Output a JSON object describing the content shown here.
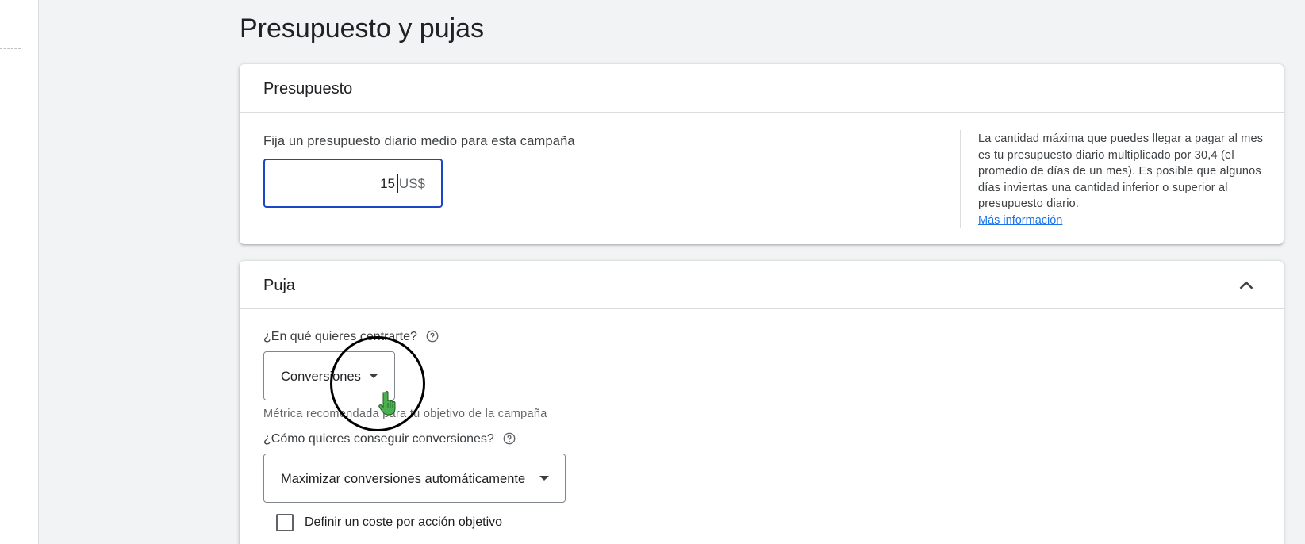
{
  "page": {
    "title": "Presupuesto y pujas"
  },
  "budget": {
    "header_title": "Presupuesto",
    "label": "Fija un presupuesto diario medio para esta campaña",
    "input_value": "15",
    "currency": "US$",
    "help_text": "La cantidad máxima que puedes llegar a pagar al mes es tu presupuesto diario multiplicado por 30,4 (el promedio de días de un mes). Es posible que algunos días inviertas una cantidad inferior o superior al presupuesto diario.",
    "help_link": "Más información"
  },
  "bid": {
    "header_title": "Puja",
    "question_focus": "¿En qué quieres centrarte?",
    "focus_selected": "Conversiones",
    "focus_hint": "Métrica recomendada para tu objetivo de la campaña",
    "question_how": "¿Cómo quieres conseguir conversiones?",
    "how_selected": "Maximizar conversiones automáticamente",
    "target_cpa_label": "Definir un coste por acción objetivo",
    "target_cpa_checked": false
  },
  "colors": {
    "page_background": "#f1f3f4",
    "card_background": "#ffffff",
    "focus_border": "#1a47c4",
    "link": "#1a73e8",
    "cursor_hand": "#4caf50"
  },
  "icons": {
    "collapse": "chevron-up-icon",
    "help": "help-circle-icon",
    "dropdown": "caret-down-icon",
    "cursor": "hand-pointer-icon"
  }
}
